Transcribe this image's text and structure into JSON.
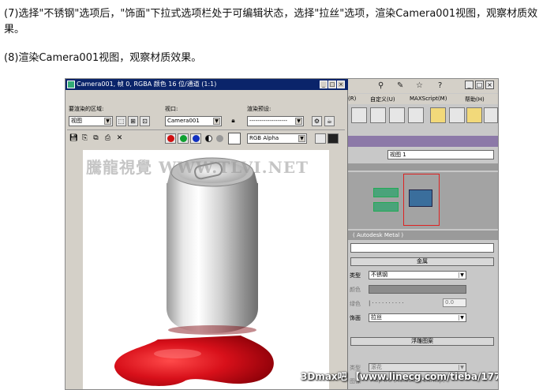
{
  "article": {
    "para1": "(7)选择\"不锈钢\"选项后，\"饰面\"下拉式选项栏处于可编辑状态，选择\"拉丝\"选项，渲染Camera001视图，观察材质效果。",
    "para2": "(8)渲染Camera001视图，观察材质效果。"
  },
  "render_window": {
    "title": "Camera001, 帧 0, RGBA 颜色 16 位/通道 (1:1)",
    "area_label": "要渲染的区域:",
    "area_value": "视图",
    "viewport_label": "视口:",
    "viewport_value": "Camera001",
    "preset_label": "渲染预设:",
    "preset_value": "-------------------",
    "channel_value": "RGB Alpha",
    "watermark": "騰龍視覺 WWW.TLVI.NET"
  },
  "max_panel": {
    "menu_items": [
      "(R)",
      "自定义(U)",
      "MAXScript(M)",
      "帮助(H)"
    ],
    "view_select": "视图 1",
    "material_bar": "( Autodesk Metal )",
    "section_metal": "金属",
    "type_label": "类型",
    "type_value": "不锈钢",
    "color_label": "颜色",
    "patina_label": "绿色",
    "patina_value": "0.0",
    "finish_label": "饰面",
    "finish_value": "拉丝",
    "section_relief": "浮雕图案",
    "relief_type_label": "类型",
    "relief_type_value": "滚花",
    "relief_map": "Map #6 (Autodesk Bitmap)",
    "relief_image_label": "图像"
  },
  "footer_watermark": "3Dmax吧 【www.linecg.com/tieba/1771】",
  "colors": {
    "titlebar": "#0a246a",
    "liquid": "#d8101a",
    "blue_node": "#3a6e9c",
    "green_node": "#4aa37a"
  }
}
